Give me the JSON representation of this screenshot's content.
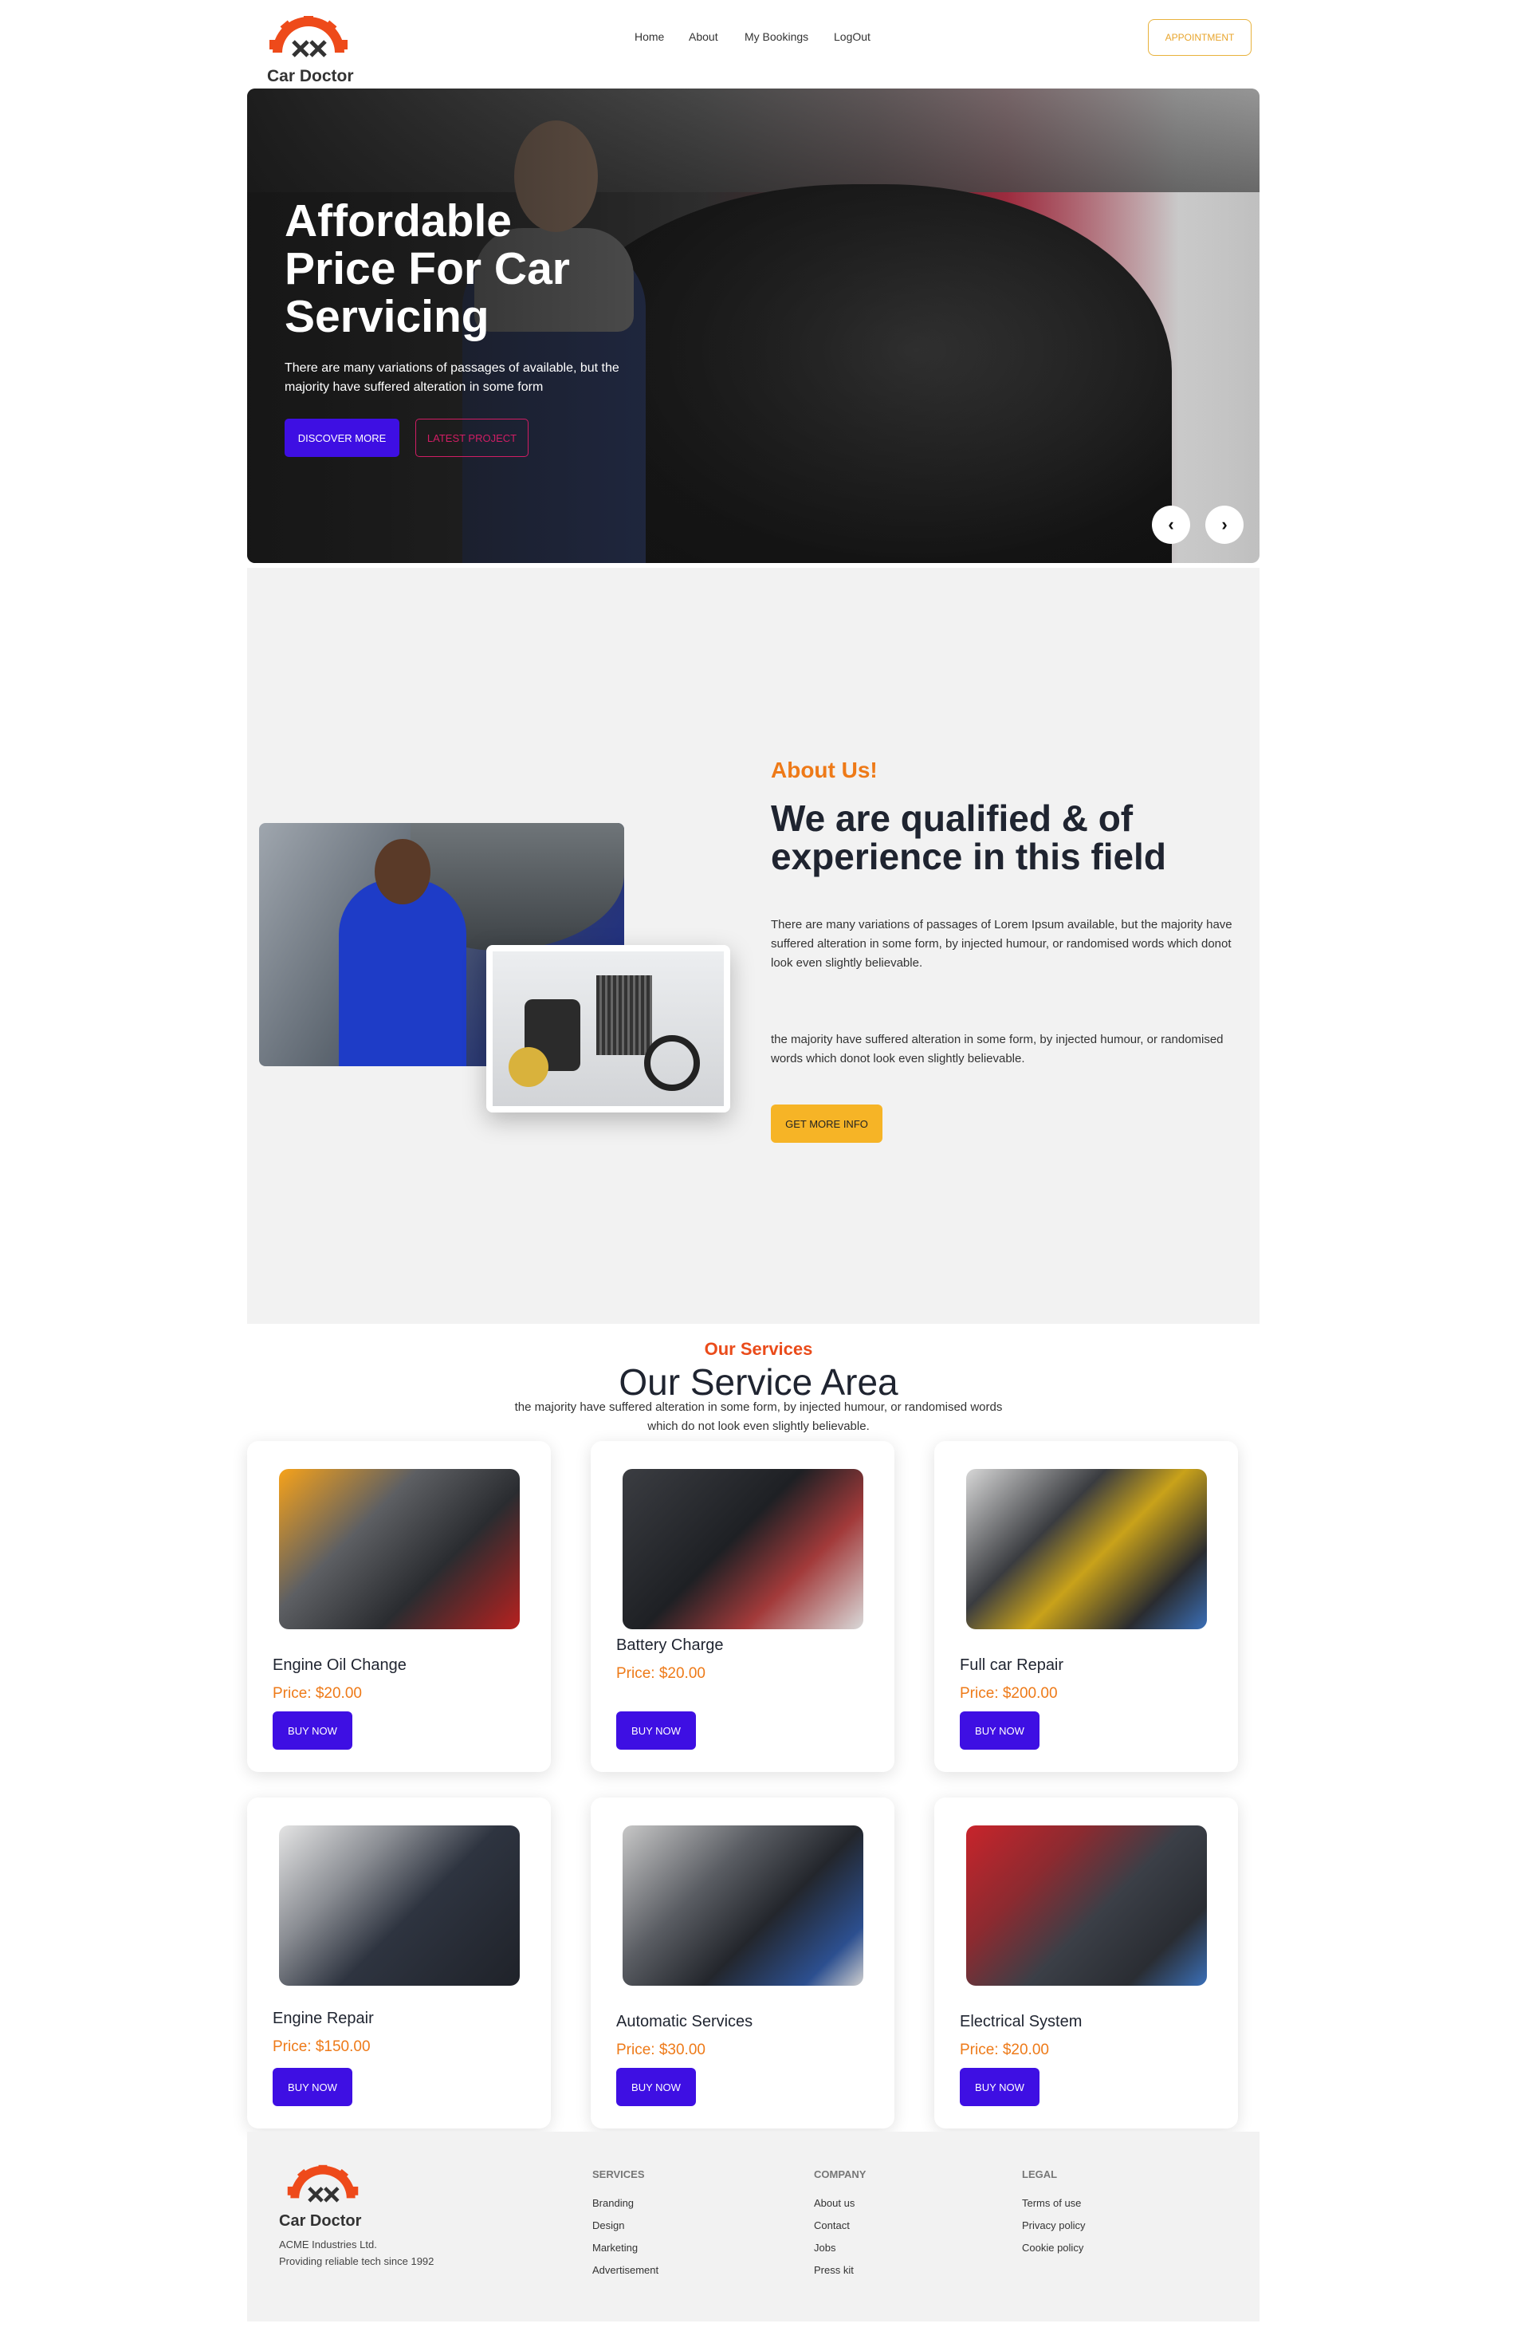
{
  "brand": {
    "name": "Car Doctor",
    "logo_colors": {
      "gear": "#ee4a1a",
      "tools": "#333333"
    }
  },
  "nav": {
    "links": [
      "Home",
      "About",
      "My Bookings",
      "LogOut"
    ],
    "appointment_label": "Appointment"
  },
  "hero": {
    "title": "Affordable Price For Car Servicing",
    "subtitle": "There are many variations of passages of available, but the majority have suffered alteration in some form",
    "discover_label": "Discover More",
    "latest_label": "Latest Project",
    "prev_icon": "‹",
    "next_icon": "›"
  },
  "about": {
    "label": "About Us!",
    "title": "We are qualified & of experience in this field",
    "paragraph1": "There are many variations of passages of Lorem Ipsum available, but the majority have suffered alteration in some form, by injected humour, or randomised words which donot look even slightly believable.",
    "paragraph2": "the majority have suffered alteration in some form, by injected humour, or randomised words which donot look even slightly believable.",
    "button_label": "Get More Info"
  },
  "services": {
    "label": "Our Services",
    "title": "Our Service Area",
    "subtitle": "the majority have suffered alteration in some form, by injected humour, or randomised words which do not look even slightly believable.",
    "items": [
      {
        "name": "Engine Oil Change",
        "price": "Price: $20.00",
        "button": "Buy Now"
      },
      {
        "name": "Battery Charge",
        "price": "Price: $20.00",
        "button": "Buy Now"
      },
      {
        "name": "Full car Repair",
        "price": "Price: $200.00",
        "button": "Buy Now"
      },
      {
        "name": "Engine Repair",
        "price": "Price: $150.00",
        "button": "Buy Now"
      },
      {
        "name": "Automatic Services",
        "price": "Price: $30.00",
        "button": "Buy Now"
      },
      {
        "name": "Electrical System",
        "price": "Price: $20.00",
        "button": "Buy Now"
      }
    ]
  },
  "footer": {
    "brand": "Car Doctor",
    "company_line1": "ACME Industries Ltd.",
    "company_line2": "Providing reliable tech since 1992",
    "columns": [
      {
        "heading": "Services",
        "links": [
          "Branding",
          "Design",
          "Marketing",
          "Advertisement"
        ]
      },
      {
        "heading": "Company",
        "links": [
          "About us",
          "Contact",
          "Jobs",
          "Press kit"
        ]
      },
      {
        "heading": "Legal",
        "links": [
          "Terms of use",
          "Privacy policy",
          "Cookie policy"
        ]
      }
    ]
  },
  "colors": {
    "primary_button": "#3e0fe3",
    "accent_orange": "#ee7a18",
    "accent_red": "#ea4b1a",
    "appointment_border": "#e8b23c",
    "get_info_button": "#f6b426"
  }
}
